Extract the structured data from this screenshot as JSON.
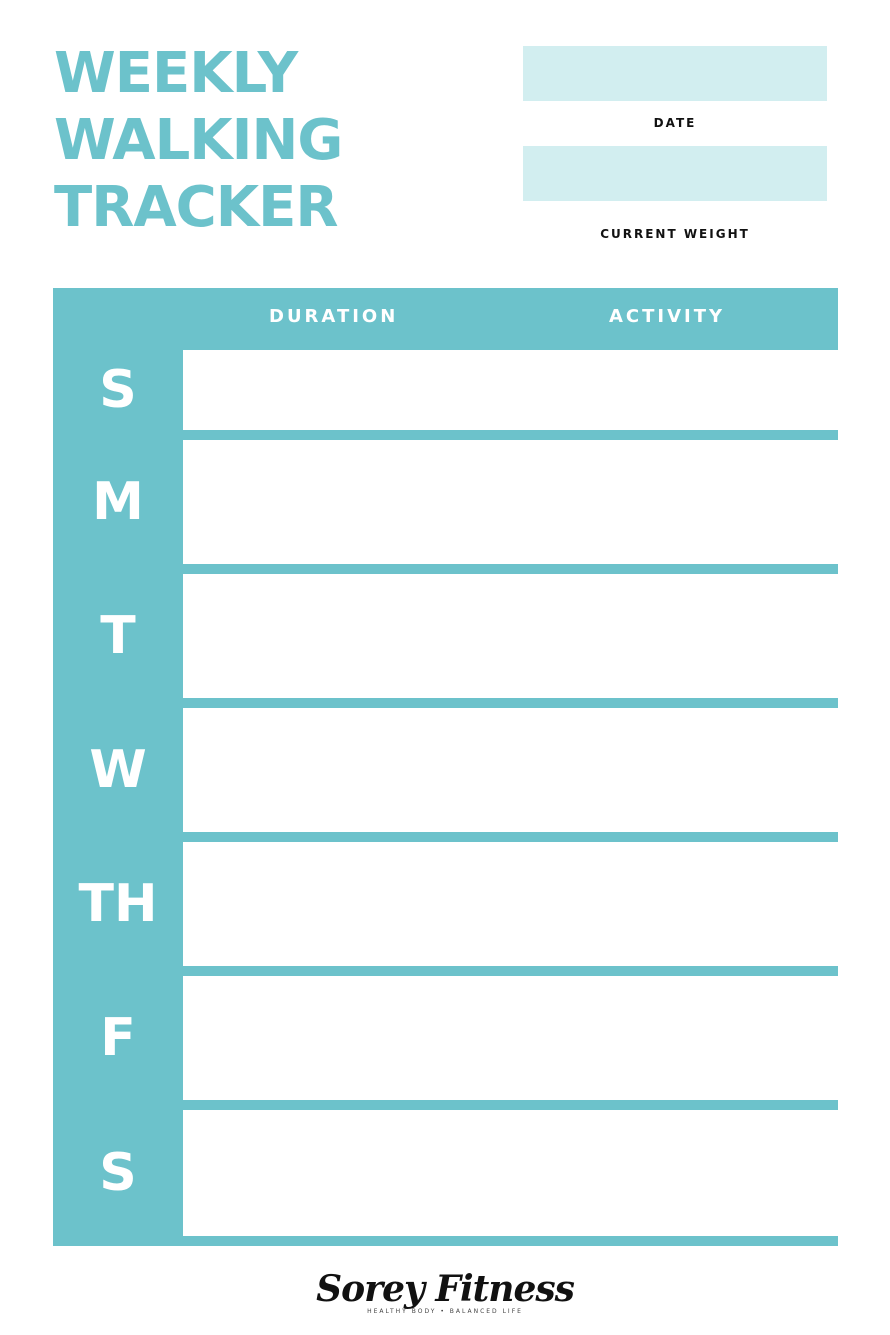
{
  "title": {
    "line1": "WEEKLY",
    "line2": "WALKING",
    "line3": "TRACKER"
  },
  "fields": {
    "date_label": "DATE",
    "weight_label": "CURRENT WEIGHT"
  },
  "table": {
    "columns": [
      "DURATION",
      "ACTIVITY"
    ],
    "days": [
      "S",
      "M",
      "T",
      "W",
      "TH",
      "F",
      "S"
    ]
  },
  "logo": {
    "name": "Sorey Fitness",
    "tagline": "HEALTHY BODY • BALANCED LIFE"
  },
  "colors": {
    "accent": "#6cc2cb",
    "field_fill": "#d2eef0"
  }
}
